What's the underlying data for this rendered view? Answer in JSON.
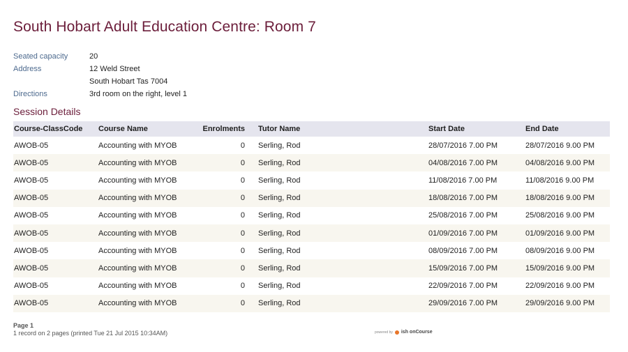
{
  "title": "South Hobart Adult Education Centre: Room 7",
  "meta": [
    {
      "label": "Seated capacity",
      "value": "20"
    },
    {
      "label": "Address",
      "value": "12 Weld Street"
    },
    {
      "label": "",
      "value": "South Hobart Tas 7004"
    },
    {
      "label": "Directions",
      "value": "3rd room on the right, level 1"
    }
  ],
  "section_title": "Session Details",
  "table": {
    "headers": [
      "Course-ClassCode",
      "Course Name",
      "Enrolments",
      "Tutor Name",
      "Start Date",
      "End Date"
    ],
    "rows": [
      [
        "AWOB-05",
        "Accounting with MYOB",
        "0",
        "Serling, Rod",
        "28/07/2016 7.00 PM",
        "28/07/2016 9.00 PM"
      ],
      [
        "AWOB-05",
        "Accounting with MYOB",
        "0",
        "Serling, Rod",
        "04/08/2016 7.00 PM",
        "04/08/2016 9.00 PM"
      ],
      [
        "AWOB-05",
        "Accounting with MYOB",
        "0",
        "Serling, Rod",
        "11/08/2016 7.00 PM",
        "11/08/2016 9.00 PM"
      ],
      [
        "AWOB-05",
        "Accounting with MYOB",
        "0",
        "Serling, Rod",
        "18/08/2016 7.00 PM",
        "18/08/2016 9.00 PM"
      ],
      [
        "AWOB-05",
        "Accounting with MYOB",
        "0",
        "Serling, Rod",
        "25/08/2016 7.00 PM",
        "25/08/2016 9.00 PM"
      ],
      [
        "AWOB-05",
        "Accounting with MYOB",
        "0",
        "Serling, Rod",
        "01/09/2016 7.00 PM",
        "01/09/2016 9.00 PM"
      ],
      [
        "AWOB-05",
        "Accounting with MYOB",
        "0",
        "Serling, Rod",
        "08/09/2016 7.00 PM",
        "08/09/2016 9.00 PM"
      ],
      [
        "AWOB-05",
        "Accounting with MYOB",
        "0",
        "Serling, Rod",
        "15/09/2016 7.00 PM",
        "15/09/2016 9.00 PM"
      ],
      [
        "AWOB-05",
        "Accounting with MYOB",
        "0",
        "Serling, Rod",
        "22/09/2016 7.00 PM",
        "22/09/2016 9.00 PM"
      ],
      [
        "AWOB-05",
        "Accounting with MYOB",
        "0",
        "Serling, Rod",
        "29/09/2016 7.00 PM",
        "29/09/2016 9.00 PM"
      ]
    ]
  },
  "footer": {
    "page_label": "Page 1",
    "summary": "1 record on 2 pages (printed Tue 21 Jul 2015 10:34AM)",
    "powered_by": "powered by",
    "brand": "ish onCourse",
    "logo_icon": "ish-logo-icon"
  },
  "colors": {
    "title": "#6b1d3a",
    "label": "#4d6a8e",
    "header_bg": "#e5e5ee",
    "stripe_bg": "#f8f6ef"
  }
}
